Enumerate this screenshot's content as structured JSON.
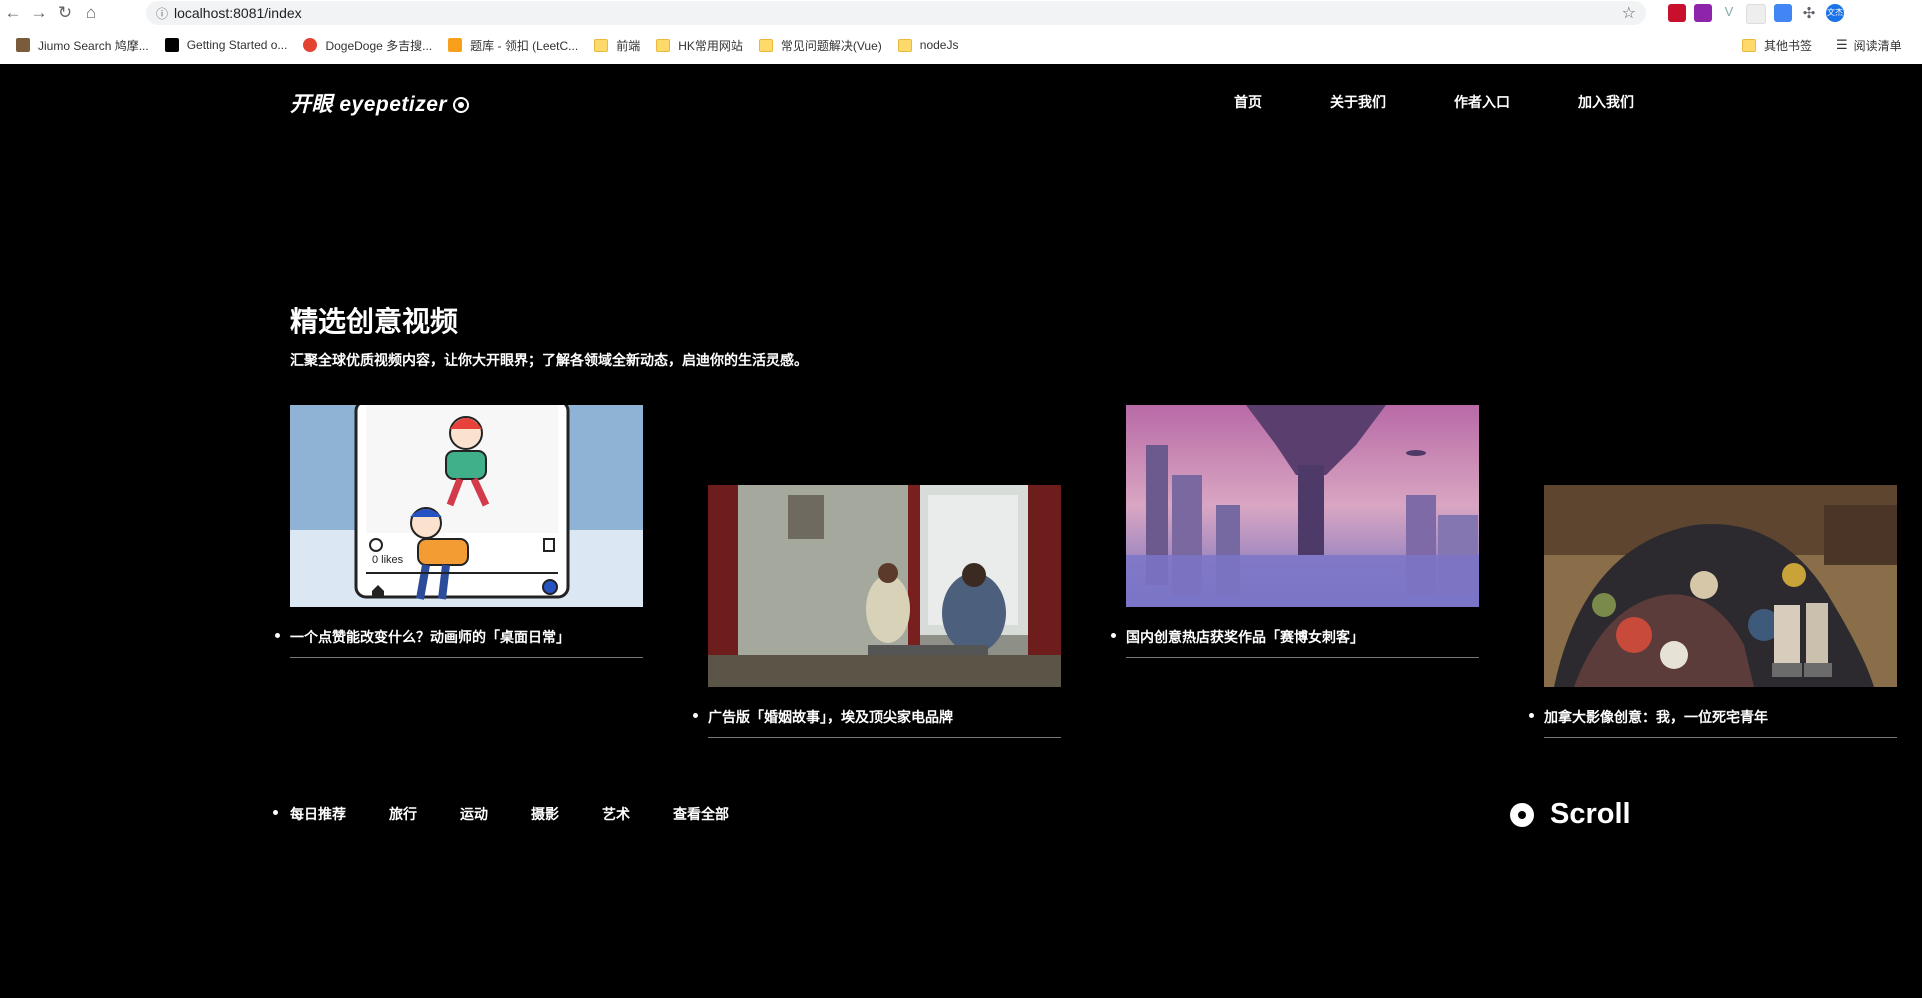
{
  "browser": {
    "url": "localhost:8081/index",
    "bookmarks": [
      {
        "label": "Jiumo Search 鸠摩...",
        "icon": "jiumo-icon",
        "color": "#7a5c3a"
      },
      {
        "label": "Getting Started o...",
        "icon": "notion-icon",
        "color": "#000000"
      },
      {
        "label": "DogeDoge 多吉搜...",
        "icon": "dogedoge-icon",
        "color": "#e44332"
      },
      {
        "label": "题库 - 领扣 (LeetC...",
        "icon": "leetcode-icon",
        "color": "#f89f1b"
      },
      {
        "label": "前端",
        "icon": "folder-icon"
      },
      {
        "label": "HK常用网站",
        "icon": "folder-icon"
      },
      {
        "label": "常见问题解决(Vue)",
        "icon": "folder-icon"
      },
      {
        "label": "nodeJs",
        "icon": "folder-icon"
      }
    ],
    "other_bookmarks": "其他书签",
    "reading_list": "阅读清单",
    "profile": "文杰"
  },
  "site": {
    "logo": "开眼 eyepetizer",
    "nav": [
      "首页",
      "关于我们",
      "作者入口",
      "加入我们"
    ],
    "title": "精选创意视频",
    "subtitle": "汇聚全球优质视频内容，让你大开眼界；了解各领域全新动态，启迪你的生活灵感。",
    "cards": [
      {
        "caption": "一个点赞能改变什么？动画师的「桌面日常」",
        "thumb": "illustration-likes"
      },
      {
        "caption": "广告版「婚姻故事」，埃及顶尖家电品牌",
        "thumb": "couple-window"
      },
      {
        "caption": "国内创意热店获奖作品「赛博女刺客」",
        "thumb": "cyber-city"
      },
      {
        "caption": "加拿大影像创意：我，一位死宅青年",
        "thumb": "clothes-pile"
      }
    ],
    "categories": [
      "每日推荐",
      "旅行",
      "运动",
      "摄影",
      "艺术",
      "查看全部"
    ],
    "scroll": "Scroll"
  }
}
